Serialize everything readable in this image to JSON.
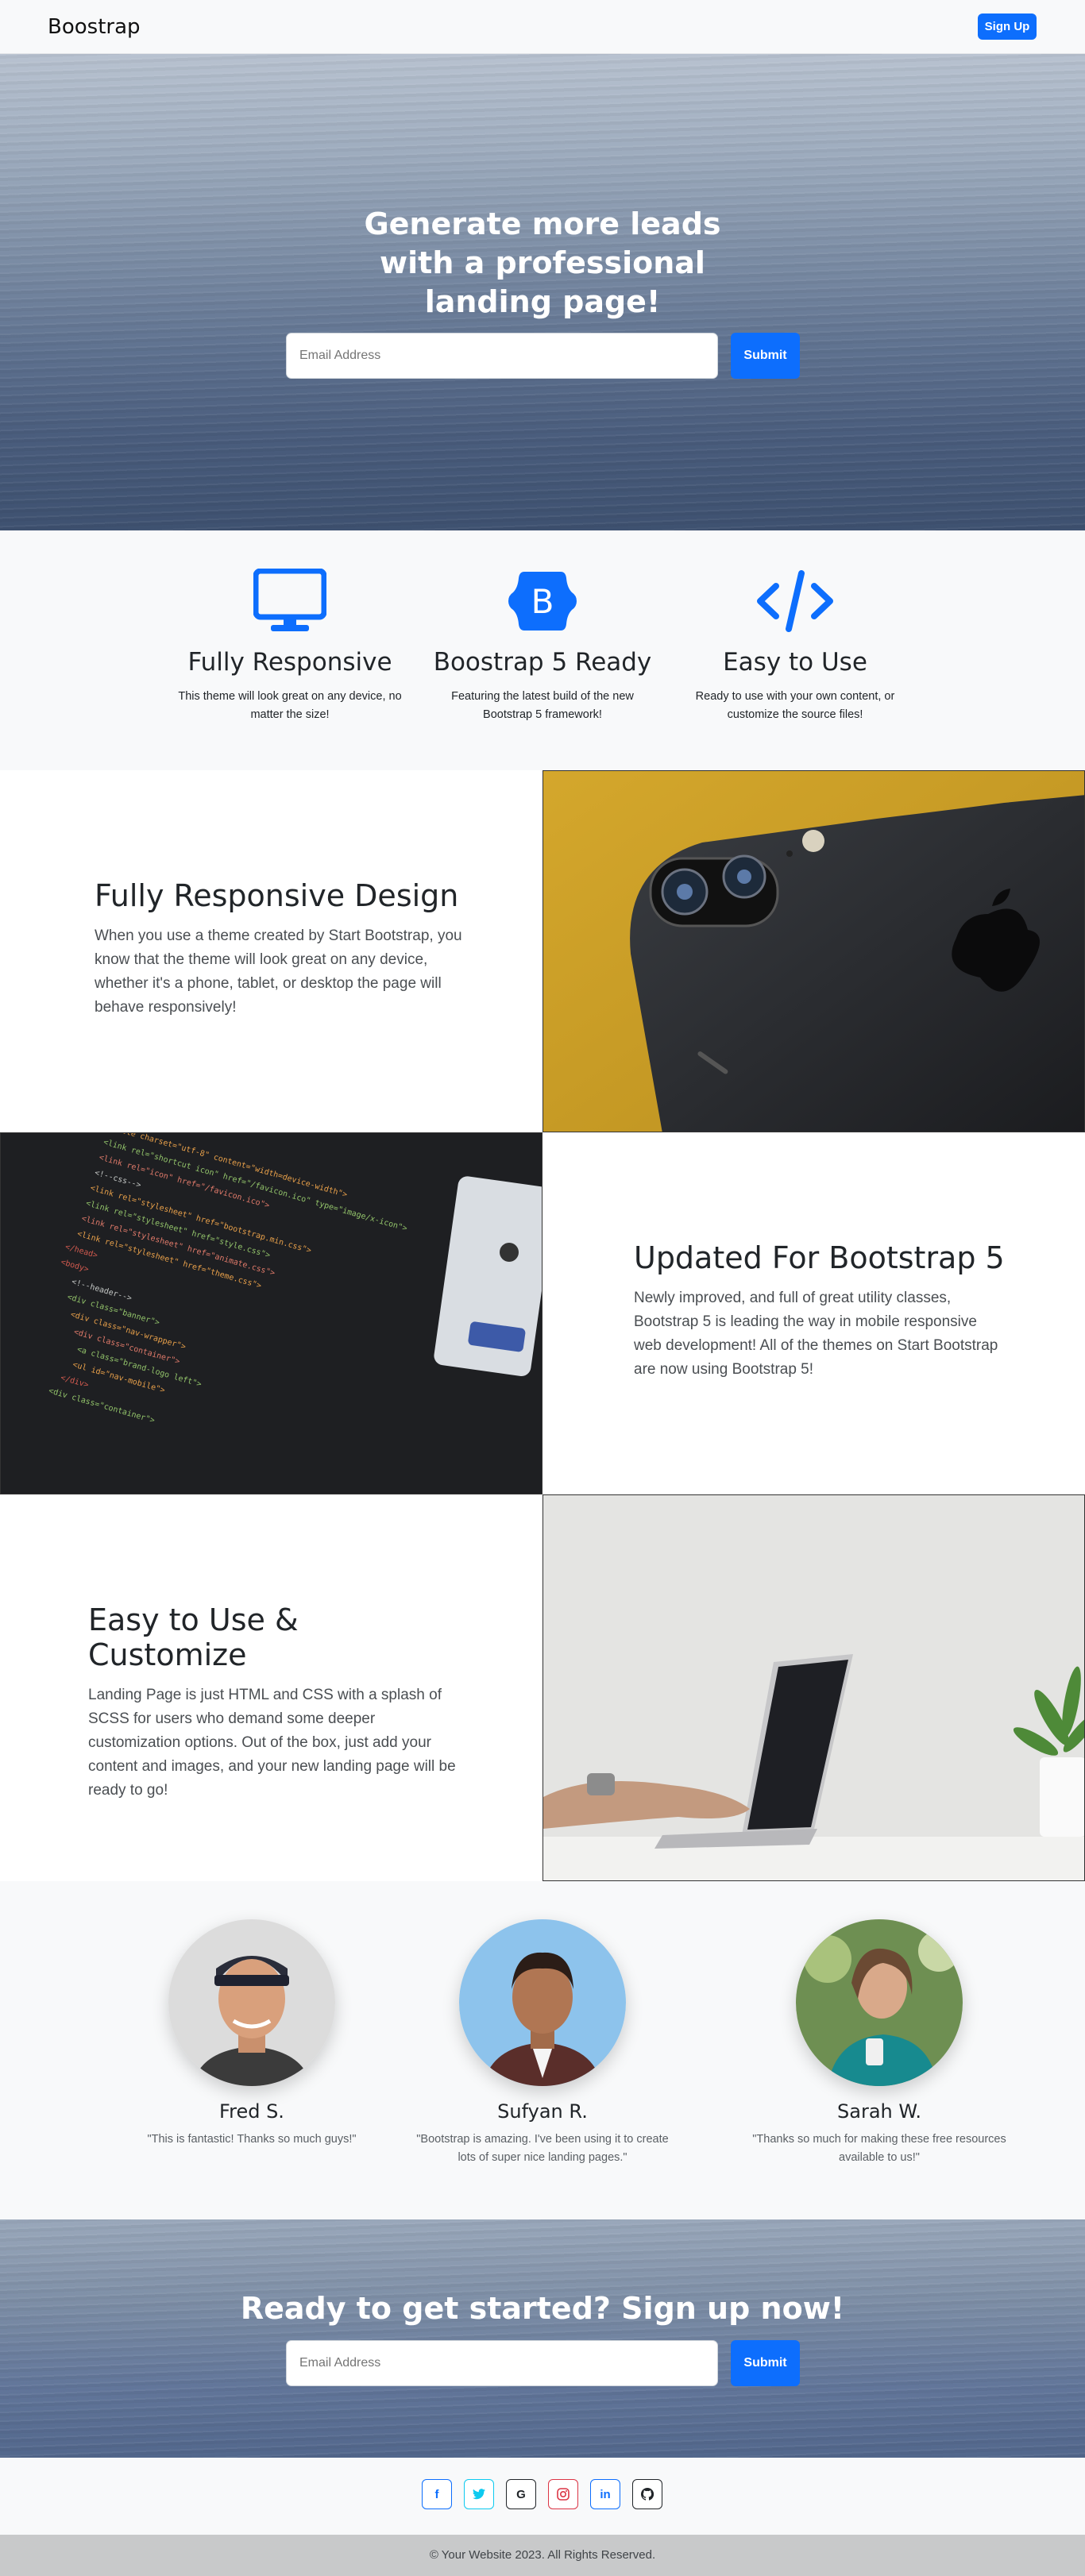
{
  "navbar": {
    "brand": "Boostrap",
    "signup_label": "Sign Up"
  },
  "hero": {
    "title": "Generate more leads with a professional landing page!",
    "email_placeholder": "Email Address",
    "submit_label": "Submit"
  },
  "features": [
    {
      "icon": "monitor-icon",
      "title": "Fully Responsive",
      "text": "This theme will look great on any device, no matter the size!"
    },
    {
      "icon": "bootstrap-icon",
      "title": "Boostrap 5 Ready",
      "text": "Featuring the latest build of the new Bootstrap 5 framework!"
    },
    {
      "icon": "code-icon",
      "title": "Easy to Use",
      "text": "Ready to use with your own content, or customize the source files!"
    }
  ],
  "showcases": [
    {
      "title": "Fully Responsive Design",
      "text": "When you use a theme created by Start Bootstrap, you know that the theme will look great on any device, whether it's a phone, tablet, or desktop the page will behave responsively!"
    },
    {
      "title": "Updated For Bootstrap 5",
      "text": "Newly improved, and full of great utility classes, Bootstrap 5 is leading the way in mobile responsive web development! All of the themes on Start Bootstrap are now using Bootstrap 5!"
    },
    {
      "title": "Easy to Use & Customize",
      "text": "Landing Page is just HTML and CSS with a splash of SCSS for users who demand some deeper customization options. Out of the box, just add your content and images, and your new landing page will be ready to go!"
    }
  ],
  "testimonials": [
    {
      "name": "Fred S.",
      "quote": "\"This is fantastic! Thanks so much guys!\""
    },
    {
      "name": "Sufyan R.",
      "quote": "\"Bootstrap is amazing. I've been using it to create lots of super nice landing pages.\""
    },
    {
      "name": "Sarah W.",
      "quote": "\"Thanks so much for making these free resources available to us!\""
    }
  ],
  "cta": {
    "title": "Ready to get started? Sign up now!",
    "email_placeholder": "Email Address",
    "submit_label": "Submit"
  },
  "social": [
    {
      "icon": "facebook-icon",
      "glyph": "f",
      "color": "#0d6efd"
    },
    {
      "icon": "twitter-icon",
      "glyph": "🐦",
      "color": "#0dcaf0"
    },
    {
      "icon": "google-icon",
      "glyph": "G",
      "color": "#212529"
    },
    {
      "icon": "instagram-icon",
      "glyph": "◎",
      "color": "#dc3545"
    },
    {
      "icon": "linkedin-icon",
      "glyph": "in",
      "color": "#0d6efd"
    },
    {
      "icon": "github-icon",
      "glyph": "⌂",
      "color": "#212529"
    }
  ],
  "footer": {
    "copyright": "© Your Website 2023. All Rights Reserved."
  }
}
